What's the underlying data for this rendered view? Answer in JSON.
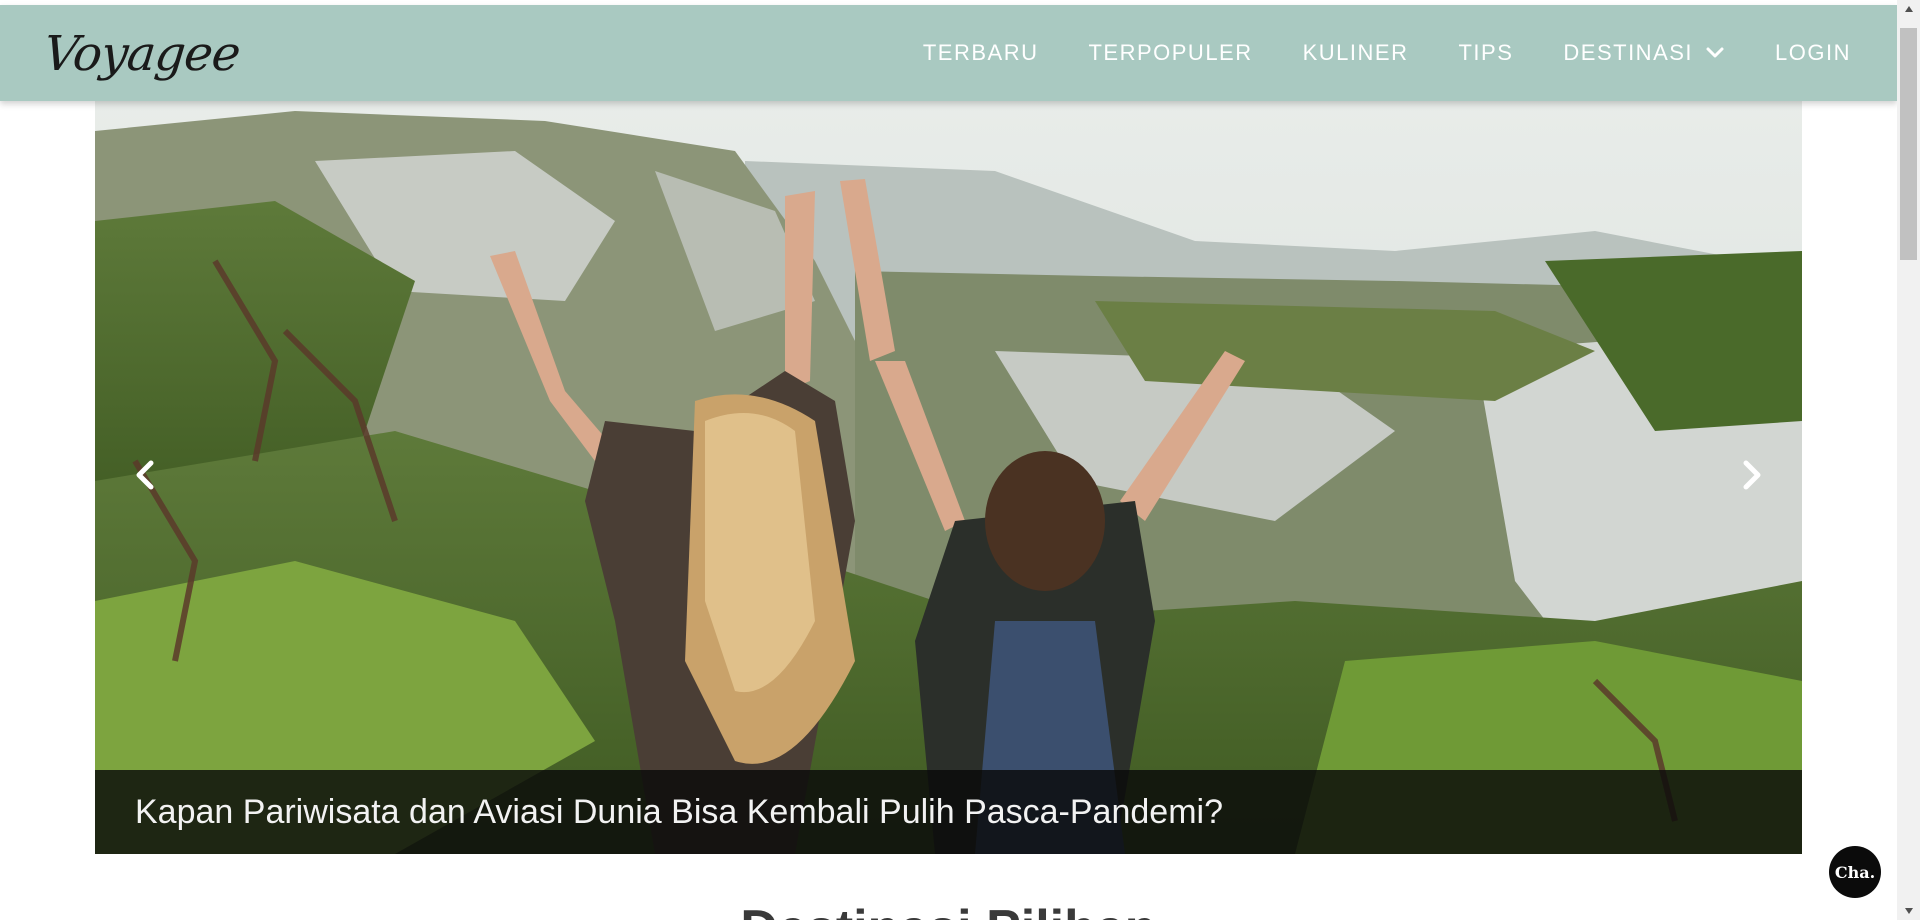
{
  "brand": {
    "logo_text": "Voyagee"
  },
  "nav": {
    "items": [
      {
        "label": "TERBARU"
      },
      {
        "label": "TERPOPULER"
      },
      {
        "label": "KULINER"
      },
      {
        "label": "TIPS"
      },
      {
        "label": "DESTINASI",
        "icon": "chevron-down-icon"
      },
      {
        "label": "LOGIN"
      }
    ]
  },
  "hero": {
    "caption": "Kapan Pariwisata dan Aviasi Dunia Bisa Kembali Pulih Pasca-Pandemi?",
    "prev_icon": "chevron-left-icon",
    "next_icon": "chevron-right-icon"
  },
  "section": {
    "title": "Destinasi Pilihan"
  },
  "chat": {
    "label": "Cha."
  },
  "colors": {
    "navbar_bg": "#a9c9c1",
    "nav_text": "#ffffff",
    "caption_bg": "#0a0a0a",
    "chat_bg": "#0b0b0b"
  }
}
